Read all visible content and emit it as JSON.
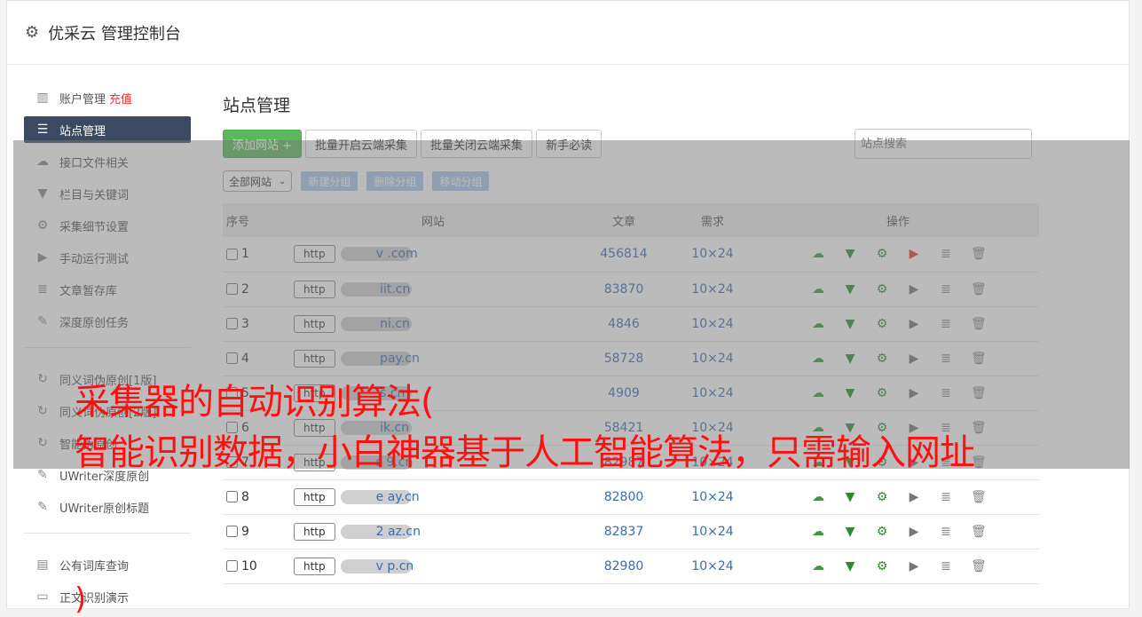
{
  "header": {
    "title": "优采云 管理控制台",
    "icon": "gear-icon"
  },
  "sidebar": {
    "group1": [
      {
        "label": "账户管理",
        "extra": "充值",
        "icon": "bar-chart-icon",
        "active": false
      },
      {
        "label": "站点管理",
        "icon": "server-icon",
        "active": true
      },
      {
        "label": "接口文件相关",
        "icon": "cloud-upload-icon",
        "active": false
      },
      {
        "label": "栏目与关键词",
        "icon": "filter-icon",
        "active": false
      },
      {
        "label": "采集细节设置",
        "icon": "cogs-icon",
        "active": false
      },
      {
        "label": "手动运行测试",
        "icon": "play-circle-icon",
        "active": false
      },
      {
        "label": "文章暂存库",
        "icon": "database-icon",
        "active": false
      },
      {
        "label": "深度原创任务",
        "icon": "edit-icon",
        "active": false
      }
    ],
    "group2": [
      {
        "label": "同义词伪原创[1版]",
        "icon": "refresh-icon"
      },
      {
        "label": "同义词伪原创[2版]",
        "icon": "refresh-icon"
      },
      {
        "label": "智能伪原创",
        "icon": "refresh-icon"
      },
      {
        "label": "UWriter深度原创",
        "icon": "edit-icon"
      },
      {
        "label": "UWriter原创标题",
        "icon": "edit-icon"
      }
    ],
    "group3": [
      {
        "label": "公有词库查询",
        "icon": "book-icon"
      },
      {
        "label": "正文识别演示",
        "icon": "desktop-icon"
      }
    ]
  },
  "main": {
    "title": "站点管理",
    "buttons": {
      "add": "添加网站 +",
      "batch_open": "批量开启云端采集",
      "batch_close": "批量关闭云端采集",
      "guide": "新手必读"
    },
    "search_placeholder": "站点搜索",
    "group_select": "全部网站",
    "group_buttons": {
      "new": "新建分组",
      "delete": "删除分组",
      "move": "移动分组"
    },
    "columns": {
      "no": "序号",
      "site": "网站",
      "articles": "文章",
      "demand": "需求",
      "ops": "操作"
    },
    "rows": [
      {
        "no": "1",
        "proto": "http",
        "domain": "v           .com",
        "articles": "456814",
        "demand": "10×24",
        "running": true
      },
      {
        "no": "2",
        "proto": "http",
        "domain": "     iit.cn",
        "articles": "83870",
        "demand": "10×24",
        "running": false
      },
      {
        "no": "3",
        "proto": "http",
        "domain": "      ni.cn",
        "articles": "4846",
        "demand": "10×24",
        "running": false
      },
      {
        "no": "4",
        "proto": "http",
        "domain": "      pay.cn",
        "articles": "58728",
        "demand": "10×24",
        "running": false
      },
      {
        "no": "5",
        "proto": "http",
        "domain": "      s.cn",
        "articles": "4909",
        "demand": "10×24",
        "running": false
      },
      {
        "no": "6",
        "proto": "http",
        "domain": "     ik.cn",
        "articles": "58421",
        "demand": "10×24",
        "running": false
      },
      {
        "no": "7",
        "proto": "http",
        "domain": "s    9.cn",
        "articles": "82987",
        "demand": "10×24",
        "running": false
      },
      {
        "no": "8",
        "proto": "http",
        "domain": "e     ay.cn",
        "articles": "82800",
        "demand": "10×24",
        "running": false
      },
      {
        "no": "9",
        "proto": "http",
        "domain": "2     az.cn",
        "articles": "82837",
        "demand": "10×24",
        "running": false
      },
      {
        "no": "10",
        "proto": "http",
        "domain": "v     p.cn",
        "articles": "82980",
        "demand": "10×24",
        "running": false
      }
    ]
  },
  "overlay_caption": {
    "line1": "采集器的自动识别算法(",
    "line2": "智能识别数据，小白神器基于人工智能算法，只需输入网址",
    "line3": ")"
  }
}
